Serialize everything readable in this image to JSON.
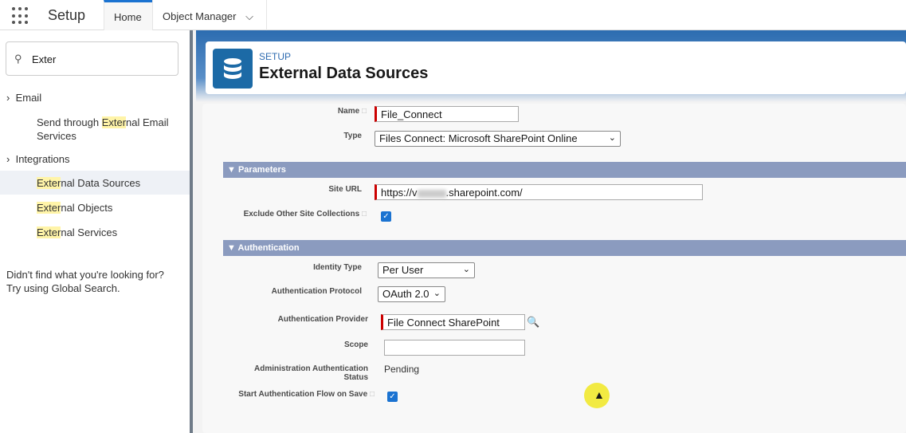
{
  "topbar": {
    "app_name": "Setup",
    "tabs": [
      {
        "label": "Home"
      },
      {
        "label": "Object Manager"
      }
    ]
  },
  "sidebar": {
    "search_value": "Exter",
    "groups": [
      {
        "label": "Email"
      },
      {
        "label": "Integrations"
      }
    ],
    "items": [
      {
        "pre": "Send through ",
        "hl": "Exter",
        "post": "nal Email Services"
      },
      {
        "pre": "",
        "hl": "Exter",
        "post": "nal Data Sources"
      },
      {
        "pre": "",
        "hl": "Exter",
        "post": "nal Objects"
      },
      {
        "pre": "",
        "hl": "Exter",
        "post": "nal Services"
      }
    ],
    "help_line1": "Didn't find what you're looking for?",
    "help_line2": "Try using Global Search."
  },
  "header": {
    "breadcrumb": "SETUP",
    "title": "External Data Sources"
  },
  "form": {
    "name_label": "Name",
    "name_value": "File_Connect",
    "type_label": "Type",
    "type_value": "Files Connect: Microsoft SharePoint Online",
    "parameters_section": "Parameters",
    "site_url_label": "Site URL",
    "site_url_prefix": "https://v",
    "site_url_suffix": ".sharepoint.com/",
    "exclude_label": "Exclude Other Site Collections",
    "exclude_checked": true,
    "auth_section": "Authentication",
    "identity_label": "Identity Type",
    "identity_value": "Per User",
    "protocol_label": "Authentication Protocol",
    "protocol_value": "OAuth 2.0",
    "provider_label": "Authentication Provider",
    "provider_value": "File Connect SharePoint",
    "scope_label": "Scope",
    "scope_value": "",
    "admin_status_label1": "Administration Authentication",
    "admin_status_label2": "Status",
    "admin_status_value": "Pending",
    "start_flow_label": "Start Authentication Flow on Save",
    "start_flow_checked": true
  }
}
